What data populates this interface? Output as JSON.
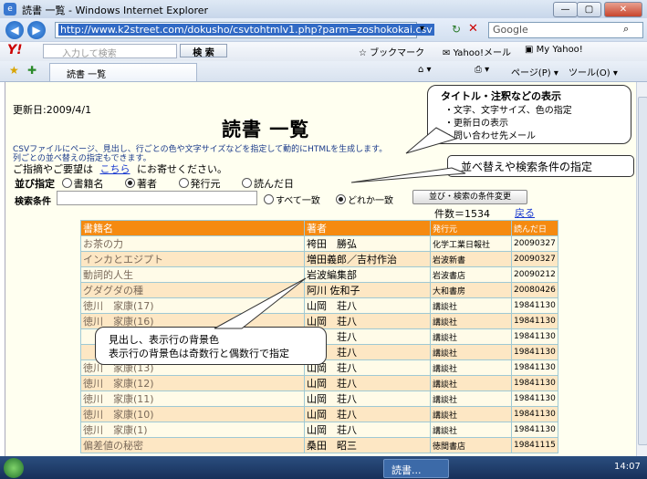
{
  "window": {
    "title": "読書 一覧 - Windows Internet Explorer"
  },
  "address": {
    "url": "http://www.k2street.com/dokusho/csvtohtmlv1.php?parm=zoshokokai.csv",
    "search_placeholder": "Google"
  },
  "yahoo": {
    "search_placeholder": "入力して検索",
    "search_button": "検 索",
    "bookmark": "ブックマーク",
    "mail": "Yahoo!メール",
    "myyahoo": "My Yahoo!"
  },
  "tab": {
    "label": "読書 一覧",
    "page_menu": "ページ(P)",
    "tools_menu": "ツール(O)"
  },
  "page": {
    "updated": "更新日:2009/4/1",
    "title": "読書 一覧",
    "desc1": "CSVファイルにページ、見出し、行ごとの色や文字サイズなどを指定して動的にHTMLを生成します。",
    "desc2": "列ごとの並べ替えの指定もできます。",
    "contact_pre": "ご指摘やご要望は",
    "contact_link": "こちら",
    "contact_post": "にお寄せください。",
    "sort_label": "並び指定",
    "sort_options": [
      "書籍名",
      "著者",
      "発行元",
      "読んだ日"
    ],
    "search_label": "検索条件",
    "match_all": "すべて一致",
    "match_any": "どれか一致",
    "change_button": "並び・検索の条件変更",
    "count": "件数＝1534",
    "back": "戻る"
  },
  "table": {
    "headers": [
      "書籍名",
      "著者",
      "発行元",
      "読んだ日"
    ],
    "rows": [
      [
        "お茶の力",
        "袴田　勝弘",
        "化学工業日報社",
        "20090327"
      ],
      [
        "インカとエジプト",
        "増田義郎／吉村作治",
        "岩波新書",
        "20090327"
      ],
      [
        "動詞的人生",
        "岩波編集部",
        "岩波書店",
        "20090212"
      ],
      [
        "グダグダの種",
        "阿川 佐和子",
        "大和書房",
        "20080426"
      ],
      [
        "徳川　家康(17)",
        "山岡　荘八",
        "講談社",
        "19841130"
      ],
      [
        "徳川　家康(16)",
        "山岡　荘八",
        "講談社",
        "19841130"
      ],
      [
        "",
        "山岡　荘八",
        "講談社",
        "19841130"
      ],
      [
        "",
        "山岡　荘八",
        "講談社",
        "19841130"
      ],
      [
        "徳川　家康(13)",
        "山岡　荘八",
        "講談社",
        "19841130"
      ],
      [
        "徳川　家康(12)",
        "山岡　荘八",
        "講談社",
        "19841130"
      ],
      [
        "徳川　家康(11)",
        "山岡　荘八",
        "講談社",
        "19841130"
      ],
      [
        "徳川　家康(10)",
        "山岡　荘八",
        "講談社",
        "19841130"
      ],
      [
        "徳川　家康(1)",
        "山岡　荘八",
        "講談社",
        "19841130"
      ],
      [
        "偏差値の秘密",
        "桑田　昭三",
        "徳間書店",
        "19841115"
      ]
    ]
  },
  "callouts": {
    "title_heading": "タイトル・注釈などの表示",
    "title_items": [
      "・文字、文字サイズ、色の指定",
      "・更新日の表示",
      "・問い合わせ先メール"
    ],
    "sort": "並べ替えや検索条件の指定",
    "rows_line1": "見出し、表示行の背景色",
    "rows_line2": "表示行の背景色は奇数行と偶数行で指定"
  },
  "taskbar": {
    "app": "読書...",
    "clock": "14:07"
  }
}
